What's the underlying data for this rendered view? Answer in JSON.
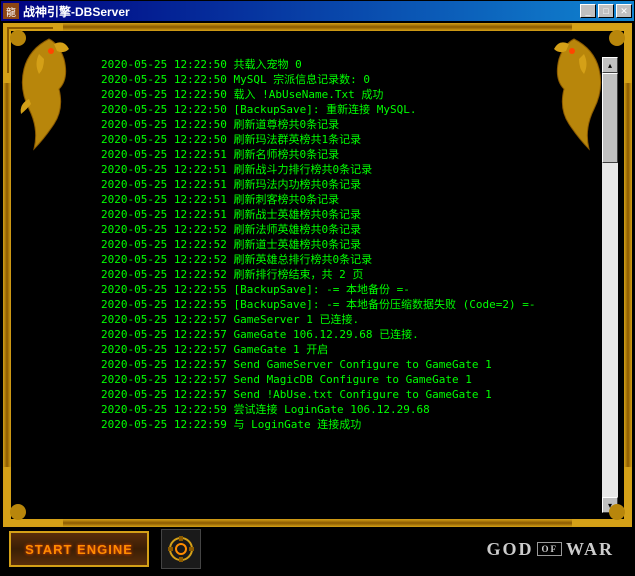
{
  "window": {
    "title": "战神引擎-DBServer"
  },
  "log": {
    "lines": [
      "2020-05-25 12:22:50 共载入宠物 0",
      "2020-05-25 12:22:50 MySQL 宗派信息记录数: 0",
      "2020-05-25 12:22:50 载入 !AbUseName.Txt 成功",
      "2020-05-25 12:22:50 [BackupSave]: 重新连接 MySQL.",
      "2020-05-25 12:22:50 刷新道尊榜共0条记录",
      "2020-05-25 12:22:50 刷新玛法群英榜共1条记录",
      "2020-05-25 12:22:51 刷新名师榜共0条记录",
      "2020-05-25 12:22:51 刷新战斗力排行榜共0条记录",
      "2020-05-25 12:22:51 刷新玛法内功榜共0条记录",
      "2020-05-25 12:22:51 刷新刺客榜共0条记录",
      "2020-05-25 12:22:51 刷新战士英雄榜共0条记录",
      "2020-05-25 12:22:52 刷新法师英雄榜共0条记录",
      "2020-05-25 12:22:52 刷新道士英雄榜共0条记录",
      "2020-05-25 12:22:52 刷新英雄总排行榜共0条记录",
      "2020-05-25 12:22:52 刷新排行榜结束，共 2 页",
      "2020-05-25 12:22:55 [BackupSave]: -= 本地备份 =-",
      "2020-05-25 12:22:55 [BackupSave]: -= 本地备份压缩数据失败 (Code=2) =-",
      "2020-05-25 12:22:57 GameServer 1 已连接.",
      "2020-05-25 12:22:57 GameGate 106.12.29.68 已连接.",
      "2020-05-25 12:22:57 GameGate 1 开启",
      "2020-05-25 12:22:57 Send GameServer Configure to GameGate 1",
      "2020-05-25 12:22:57 Send MagicDB Configure to GameGate 1",
      "2020-05-25 12:22:57 Send !AbUse.txt Configure to GameGate 1",
      "2020-05-25 12:22:59 尝试连接 LoginGate 106.12.29.68",
      "2020-05-25 12:22:59 与 LoginGate 连接成功"
    ]
  },
  "buttons": {
    "start": "START ENGINE"
  },
  "logo": {
    "part1": "GOD",
    "of": "OF",
    "part2": "WAR"
  }
}
